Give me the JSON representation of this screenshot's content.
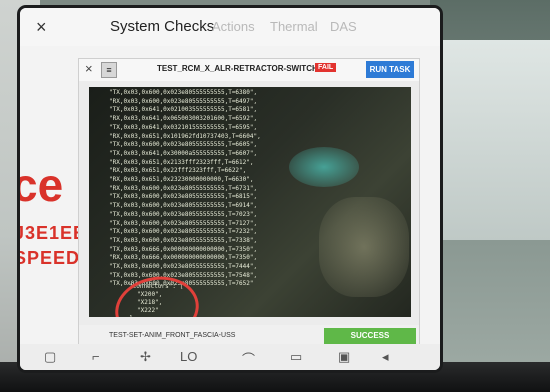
{
  "header": {
    "close": "×",
    "title": "System Checks",
    "tabs": [
      "Actions",
      "Thermal",
      "DAS"
    ]
  },
  "overlay": {
    "line1": "ce",
    "plus": "+",
    "line2": "J3E1EB",
    "line3": "SPEED"
  },
  "dialog": {
    "close": "×",
    "menu": "≡",
    "title": "TEST_RCM_X_ALR-RETRACTOR-SWITCH",
    "status": "FAIL",
    "run_label": "RUN TASK",
    "log_lines": [
      "\"TX,0x03,0x600,0x023e80555555555,T=6380\",",
      "\"RX,0x03,0x600,0x023e80555555555,T=6497\",",
      "\"TX,0x03,0x641,0x021003555555555,T=6581\",",
      "\"RX,0x03,0x641,0x065003003201600,T=6592\",",
      "\"TX,0x03,0x641,0x032101555555555,T=6595\",",
      "\"RX,0x03,0x651,0x101962fd10737403,T=6604\",",
      "\"TX,0x03,0x600,0x023e80555555555,T=6605\",",
      "\"TX,0x03,0x641,0x30000a555555555,T=6607\",",
      "\"RX,0x03,0x651,0x2133fff2323fff,T=6612\",",
      "\"RX,0x03,0x651,0x22fff2323fff,T=6622\",",
      "\"RX,0x03,0x651,0x23230000000000,T=6630\",",
      "\"RX,0x03,0x600,0x023e80555555555,T=6731\",",
      "\"TX,0x03,0x600,0x023e80555555555,T=6815\",",
      "\"TX,0x03,0x600,0x023e80555555555,T=6914\",",
      "\"TX,0x03,0x600,0x023e80555555555,T=7023\",",
      "\"TX,0x03,0x600,0x023e80555555555,T=7127\",",
      "\"TX,0x03,0x600,0x023e80555555555,T=7232\",",
      "\"TX,0x03,0x600,0x023e80555555555,T=7338\",",
      "\"TX,0x03,0x666,0x000000000000000,T=7350\",",
      "\"RX,0x03,0x666,0x000000000000000,T=7350\",",
      "\"TX,0x03,0x600,0x023e80555555555,T=7444\",",
      "\"TX,0x03,0x600,0x023e80555555555,T=7548\",",
      "\"TX,0x03,0x600,0x023e80555555555,T=7652\""
    ],
    "connectors_label": "\"connectors\": [",
    "connectors": [
      "\"X200\",",
      "\"X218\",",
      "\"X222\""
    ],
    "connectors_close": "]",
    "footer_item": "TEST-SET-ANIM_FRONT_FASCIA-USS",
    "footer_status": "SUCCESS"
  },
  "dock": {
    "icons": [
      "home-icon",
      "wiper-icon",
      "fan-icon",
      "lo-label",
      "defrost-icon",
      "seat-heat-icon",
      "rear-defrost-icon",
      "volume-icon"
    ],
    "lo_text": "LO"
  },
  "colors": {
    "fail": "#e2332f",
    "run_task": "#2e7bd6",
    "success": "#5fb848",
    "overlay_red": "#d9322a"
  }
}
